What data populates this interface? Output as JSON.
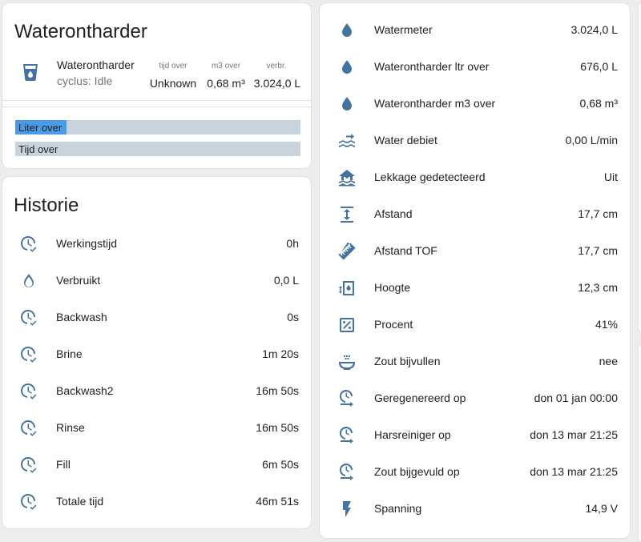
{
  "softener": {
    "title": "Waterontharder",
    "entity_name": "Waterontharder",
    "entity_state": "cyclus: Idle",
    "attributes": [
      {
        "label": "tijd over",
        "value": "Unknown"
      },
      {
        "label": "m3 over",
        "value": "0,68 m³"
      },
      {
        "label": "verbr.",
        "value": "3.024,0 L"
      }
    ],
    "bars": [
      {
        "label": "Liter over",
        "level": 0.18
      },
      {
        "label": "Tijd over",
        "level": 0
      }
    ]
  },
  "history": {
    "title": "Historie",
    "rows": [
      {
        "icon": "clock-check-icon",
        "label": "Werkingstijd",
        "value": "0h"
      },
      {
        "icon": "water-outline-icon",
        "label": "Verbruikt",
        "value": "0,0 L"
      },
      {
        "icon": "clock-check-icon",
        "label": "Backwash",
        "value": "0s"
      },
      {
        "icon": "clock-check-icon",
        "label": "Brine",
        "value": "1m 20s"
      },
      {
        "icon": "clock-check-icon",
        "label": "Backwash2",
        "value": "16m 50s"
      },
      {
        "icon": "clock-check-icon",
        "label": "Rinse",
        "value": "16m 50s"
      },
      {
        "icon": "clock-check-icon",
        "label": "Fill",
        "value": "6m 50s"
      },
      {
        "icon": "clock-check-icon",
        "label": "Totale tijd",
        "value": "46m 51s"
      }
    ]
  },
  "entities": {
    "rows": [
      {
        "icon": "water-drop-icon",
        "label": "Watermeter",
        "value": "3.024,0 L"
      },
      {
        "icon": "water-drop-icon",
        "label": "Waterontharder ltr over",
        "value": "676,0 L"
      },
      {
        "icon": "water-drop-icon",
        "label": "Waterontharder m3 over",
        "value": "0,68 m³"
      },
      {
        "icon": "waves-arrow-right-icon",
        "label": "Water debiet",
        "value": "0,00 L/min"
      },
      {
        "icon": "home-flood-icon",
        "label": "Lekkage gedetecteerd",
        "value": "Uit"
      },
      {
        "icon": "arrow-expand-vertical-icon",
        "label": "Afstand",
        "value": "17,7 cm"
      },
      {
        "icon": "ruler-icon",
        "label": "Afstand TOF",
        "value": "17,7 cm"
      },
      {
        "icon": "tank-level-icon",
        "label": "Hoogte",
        "value": "12,3 cm"
      },
      {
        "icon": "percent-box-icon",
        "label": "Procent",
        "value": "41%"
      },
      {
        "icon": "salt-bowl-icon",
        "label": "Zout bijvullen",
        "value": "nee"
      },
      {
        "icon": "clock-arrow-right-icon",
        "label": "Geregenereerd op",
        "value": "don 01 jan 00:00"
      },
      {
        "icon": "clock-arrow-right-icon",
        "label": "Harsreiniger op",
        "value": "don 13 mar 21:25"
      },
      {
        "icon": "clock-arrow-right-icon",
        "label": "Zout bijgevuld op",
        "value": "don 13 mar 21:25"
      },
      {
        "icon": "flash-icon",
        "label": "Spanning",
        "value": "14,9 V"
      }
    ]
  },
  "colors": {
    "icon": "#44739e",
    "bar_fill": "#4a9be6",
    "bar_track": "#c7d4dd"
  }
}
